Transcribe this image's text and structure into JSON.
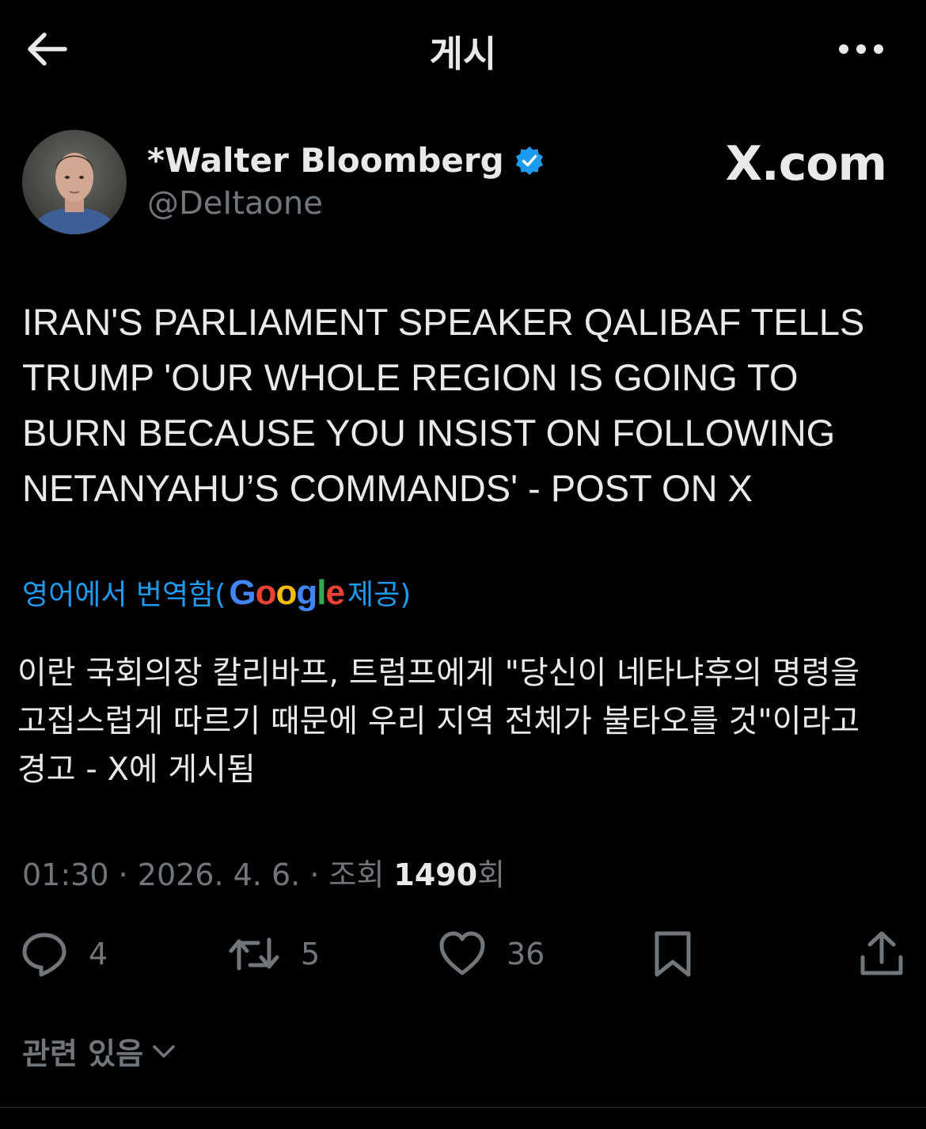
{
  "header": {
    "title": "게시",
    "back_icon": "arrow-left-icon",
    "more_icon": "more-horizontal-icon"
  },
  "author": {
    "display_name": "*Walter Bloomberg",
    "handle": "@DeItaone",
    "verified": true,
    "verified_color": "#1d9bf0"
  },
  "watermark": "X.com",
  "tweet": {
    "lines": [
      "IRAN'S PARLIAMENT SPEAKER QALIBAF TELLS",
      "TRUMP 'OUR WHOLE REGION IS GOING TO",
      "BURN BECAUSE YOU INSIST ON FOLLOWING",
      "NETANYAHU’S COMMANDS' - POST ON X"
    ]
  },
  "translation": {
    "prefix": "영어에서 번역함(",
    "provider": "Google",
    "suffix": " 제공)",
    "link_color": "#1d9bf0",
    "lines": [
      "이란 국회의장 칼리바프, 트럼프에게 \"당신이 네타냐후의 명령을",
      "고집스럽게 따르기 때문에 우리 지역 전체가 불타오를 것\"이라고",
      "경고 - X에 게시됨"
    ]
  },
  "meta": {
    "time": "01:30",
    "date": "2026. 4. 6.",
    "views_label": "조회",
    "views_count": "1490",
    "views_suffix": "회"
  },
  "actions": {
    "replies": "4",
    "reposts": "5",
    "likes": "36"
  },
  "related": {
    "label": "관련 있음"
  },
  "colors": {
    "background": "#000000",
    "text": "#e7e9ea",
    "secondary": "#71767b",
    "accent": "#1d9bf0"
  }
}
